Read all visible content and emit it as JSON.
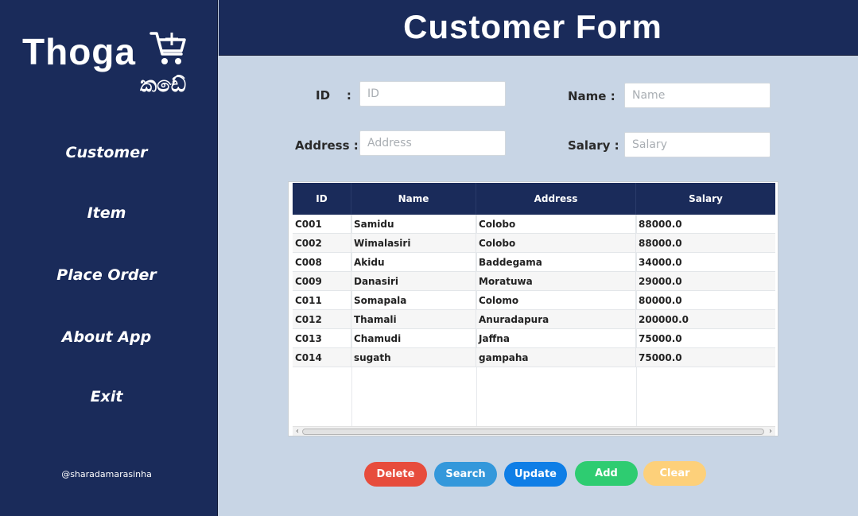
{
  "app": {
    "logo_text": "Thoga",
    "logo_subtext": "කඩේ",
    "credit": "@sharadamarasinha"
  },
  "sidebar": {
    "items": [
      {
        "label": "Customer"
      },
      {
        "label": "Item"
      },
      {
        "label": "Place Order"
      },
      {
        "label": "About App"
      },
      {
        "label": "Exit"
      }
    ]
  },
  "header": {
    "title": "Customer Form"
  },
  "form": {
    "id_label": "ID    :",
    "id_placeholder": "ID",
    "name_label": "Name :",
    "name_placeholder": "Name",
    "address_label": "Address :",
    "address_placeholder": "Address",
    "salary_label": "Salary :",
    "salary_placeholder": "Salary"
  },
  "table": {
    "columns": [
      "ID",
      "Name",
      "Address",
      "Salary"
    ],
    "rows": [
      [
        "C001",
        "Samidu",
        "Colobo",
        "88000.0"
      ],
      [
        "C002",
        "Wimalasiri",
        "Colobo",
        "88000.0"
      ],
      [
        "C008",
        "Akidu",
        "Baddegama",
        "34000.0"
      ],
      [
        "C009",
        "Danasiri",
        "Moratuwa",
        "29000.0"
      ],
      [
        "C011",
        "Somapala",
        "Colomo",
        "80000.0"
      ],
      [
        "C012",
        "Thamali",
        "Anuradapura",
        "200000.0"
      ],
      [
        "C013",
        "Chamudi",
        "Jaffna",
        "75000.0"
      ],
      [
        "C014",
        "sugath",
        "gampaha",
        "75000.0"
      ]
    ]
  },
  "buttons": {
    "delete": {
      "label": "Delete",
      "color": "#e74c3c"
    },
    "search": {
      "label": "Search",
      "color": "#3498db"
    },
    "update": {
      "label": "Update",
      "color": "#0f7ee6"
    },
    "add": {
      "label": "Add",
      "color": "#2ecc71"
    },
    "clear": {
      "label": "Clear",
      "color": "#fdd07a"
    }
  },
  "colors": {
    "sidebar_bg": "#1a2b5a",
    "content_bg": "#c8d5e5"
  },
  "icons": {
    "logo": "shopping-cart-plus-icon"
  }
}
